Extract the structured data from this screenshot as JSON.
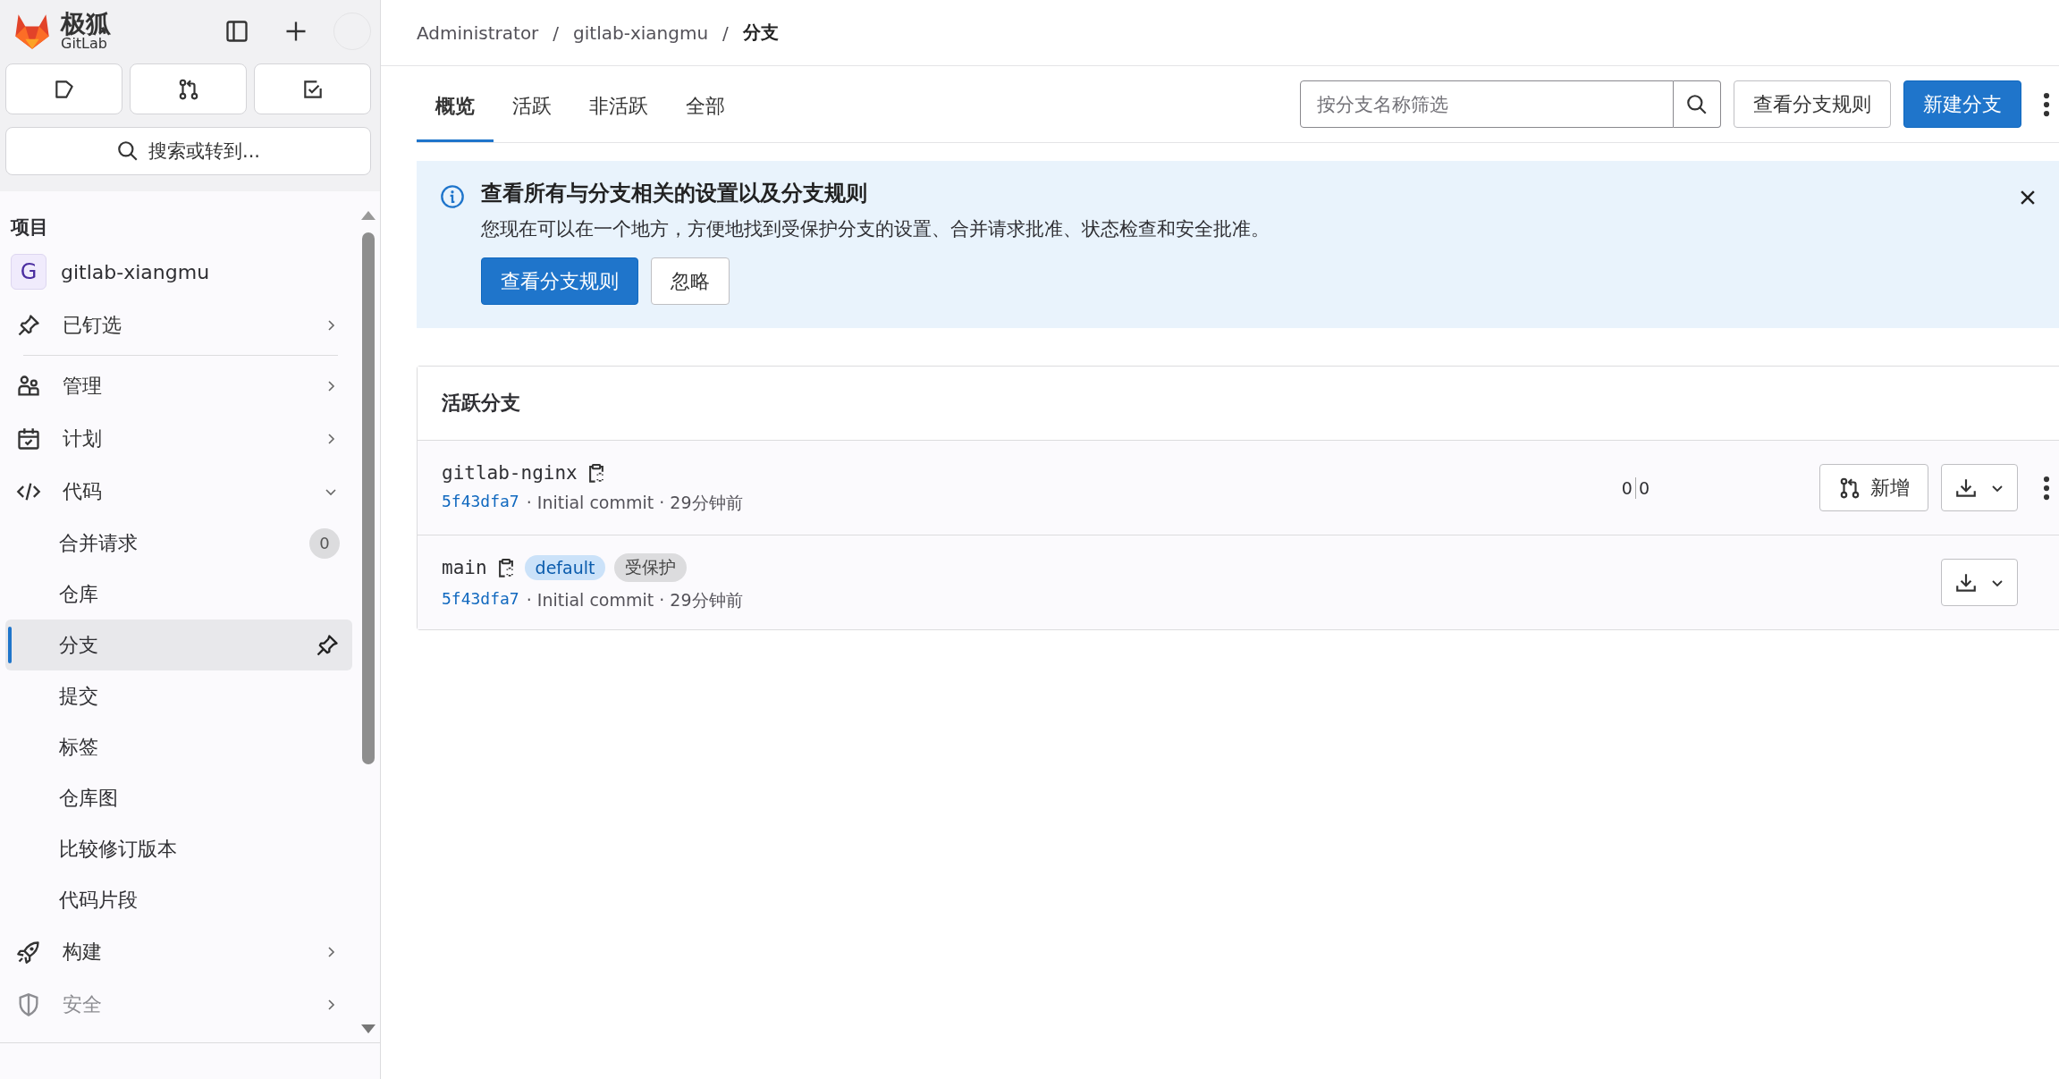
{
  "logo": {
    "name": "极狐",
    "sub": "GitLab"
  },
  "sidebar": {
    "section_title": "项目",
    "project": {
      "initial": "G",
      "name": "gitlab-xiangmu"
    },
    "items": [
      {
        "label": "已钉选",
        "expanded": false,
        "disabled": false
      },
      {
        "label": "管理",
        "expanded": false,
        "disabled": false
      },
      {
        "label": "计划",
        "expanded": false,
        "disabled": false
      },
      {
        "label": "代码",
        "expanded": true,
        "disabled": false,
        "children": [
          {
            "label": "合并请求",
            "count": "0",
            "selected": false
          },
          {
            "label": "仓库",
            "selected": false
          },
          {
            "label": "分支",
            "selected": true
          },
          {
            "label": "提交",
            "selected": false
          },
          {
            "label": "标签",
            "selected": false
          },
          {
            "label": "仓库图",
            "selected": false
          },
          {
            "label": "比较修订版本",
            "selected": false
          },
          {
            "label": "代码片段",
            "selected": false
          }
        ]
      },
      {
        "label": "构建",
        "expanded": false,
        "disabled": false
      },
      {
        "label": "安全",
        "expanded": false,
        "disabled": true
      }
    ]
  },
  "search": {
    "placeholder": "搜索或转到..."
  },
  "breadcrumbs": {
    "separator": "/",
    "items": [
      "Administrator",
      "gitlab-xiangmu",
      "分支"
    ]
  },
  "tabs": [
    {
      "label": "概览",
      "selected": true
    },
    {
      "label": "活跃",
      "selected": false
    },
    {
      "label": "非活跃",
      "selected": false
    },
    {
      "label": "全部",
      "selected": false
    }
  ],
  "filter": {
    "placeholder": "按分支名称筛选"
  },
  "header_buttons": [
    {
      "label": "查看分支规则",
      "kind": "default"
    },
    {
      "label": "新建分支",
      "kind": "primary"
    }
  ],
  "banner": {
    "title": "查看所有与分支相关的设置以及分支规则",
    "text": "您现在可以在一个地方，方便地找到受保护分支的设置、合并请求批准、状态检查和安全批准。",
    "buttons": [
      {
        "label": "查看分支规则",
        "kind": "primary"
      },
      {
        "label": "忽略",
        "kind": "default"
      }
    ]
  },
  "branches": {
    "title": "活跃分支",
    "rows": [
      {
        "name": "gitlab-nginx",
        "badges": [],
        "sha": "5f43dfa7",
        "commit": "· Initial commit · 29分钟前",
        "behind": "0",
        "ahead": "0",
        "mr_button": "新增",
        "more_menu": true
      },
      {
        "name": "main",
        "badges": [
          {
            "label": "default",
            "kind": "info"
          },
          {
            "label": "受保护",
            "kind": "neutral"
          }
        ],
        "sha": "5f43dfa7",
        "commit": "· Initial commit · 29分钟前",
        "more_menu": false
      }
    ]
  }
}
